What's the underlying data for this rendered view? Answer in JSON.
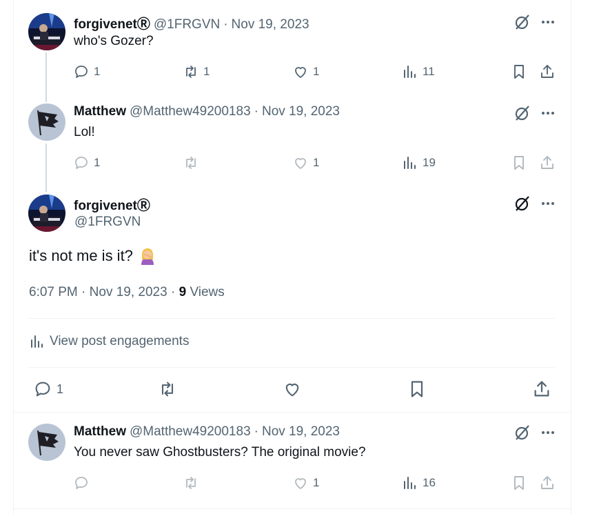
{
  "colors": {
    "text_primary": "#0f1419",
    "text_secondary": "#536471",
    "thread_line": "#cfd9de",
    "divider": "#eff3f4"
  },
  "tweets": [
    {
      "display_name": "forgivenetⓇ",
      "handle": "@1FRGVN",
      "separator": "·",
      "date": "Nov 19, 2023",
      "text": "who's Gozer?",
      "avatar_icon": "piano-player-avatar",
      "actions": {
        "replies": "1",
        "reposts": "1",
        "likes": "1",
        "views": "11"
      }
    },
    {
      "display_name": "Matthew",
      "handle": "@Matthew49200183",
      "separator": "·",
      "date": "Nov 19, 2023",
      "text": "Lol!",
      "avatar_icon": "tattered-flag-avatar",
      "actions": {
        "replies": "1",
        "reposts": "",
        "likes": "1",
        "views": "19"
      }
    },
    {
      "display_name": "Matthew",
      "handle": "@Matthew49200183",
      "separator": "·",
      "date": "Nov 19, 2023",
      "text": "You never saw Ghostbusters? The original movie?",
      "avatar_icon": "tattered-flag-avatar",
      "actions": {
        "replies": "",
        "reposts": "",
        "likes": "1",
        "views": "16"
      }
    }
  ],
  "main_tweet": {
    "display_name": "forgivenetⓇ",
    "handle": "@1FRGVN",
    "text": "it's not me is it?",
    "emoji": "woman-facepalming-emoji",
    "time": "6:07 PM",
    "separator": "·",
    "date": "Nov 19, 2023",
    "views_count": "9",
    "views_label": "Views",
    "engagements_label": "View post engagements",
    "actions": {
      "replies": "1"
    }
  }
}
